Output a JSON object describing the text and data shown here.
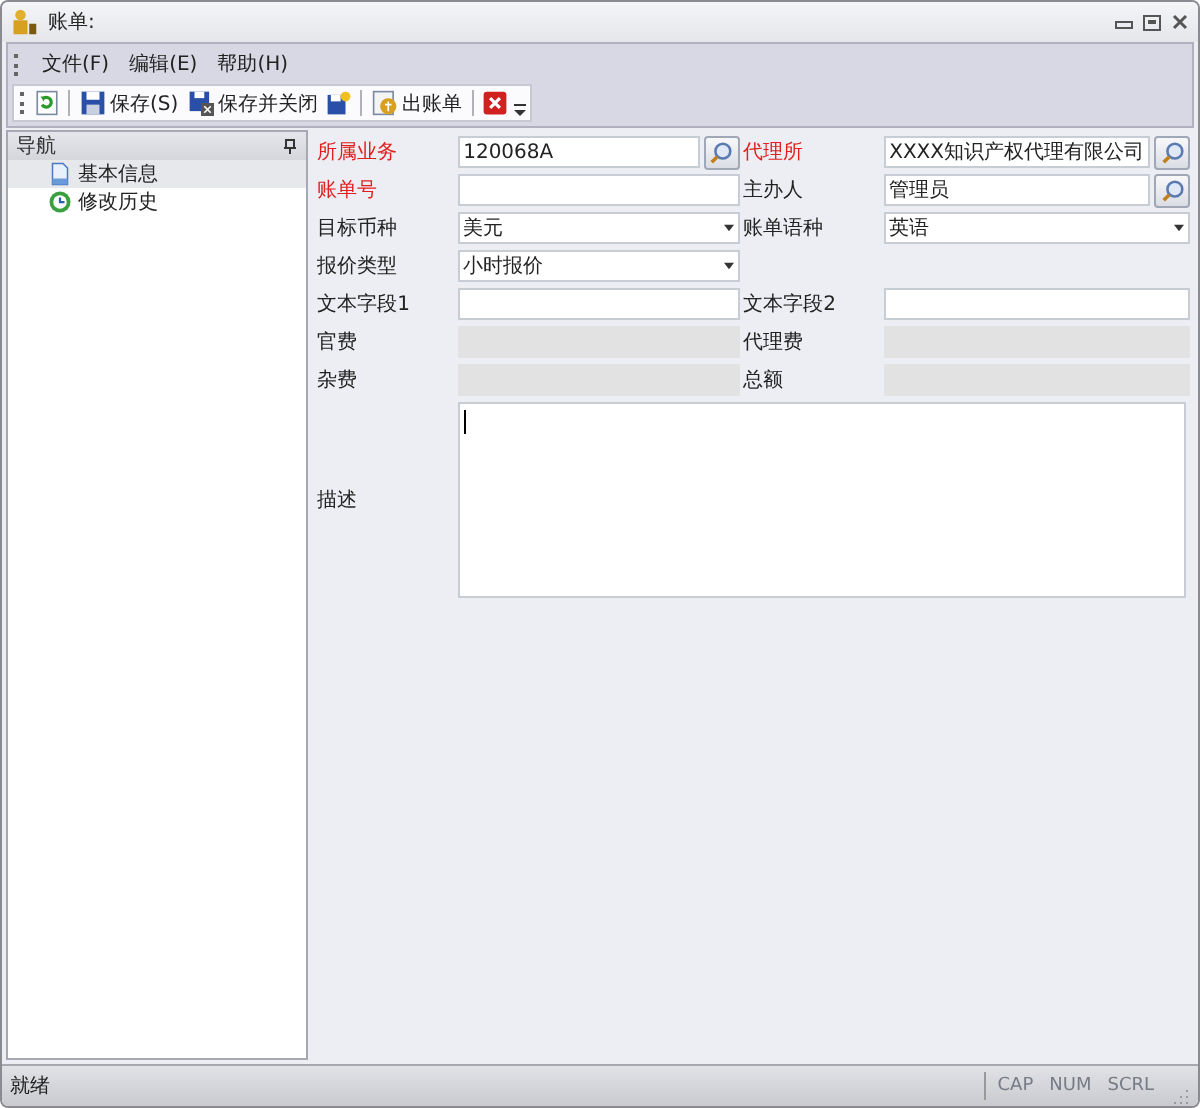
{
  "window": {
    "title": "账单:"
  },
  "menu": [
    "文件(F)",
    "编辑(E)",
    "帮助(H)"
  ],
  "toolbar": {
    "buttons": [
      "保存(S)",
      "保存并关闭",
      "出账单"
    ]
  },
  "navigation": {
    "title": "导航",
    "items": [
      {
        "label": "基本信息",
        "selected": true
      },
      {
        "label": "修改历史",
        "selected": false
      }
    ]
  },
  "form": {
    "rows": [
      [
        {
          "label": "所属业务",
          "required": true,
          "kind": "search",
          "value": "120068A"
        },
        {
          "label": "代理所",
          "required": true,
          "kind": "search",
          "value": "XXXX知识产权代理有限公司"
        }
      ],
      [
        {
          "label": "账单号",
          "required": true,
          "kind": "text"
        },
        {
          "label": "主办人",
          "required": false,
          "kind": "search",
          "value": "管理员"
        }
      ],
      [
        {
          "label": "目标币种",
          "required": false,
          "kind": "combo",
          "value": "美元"
        },
        {
          "label": "账单语种",
          "required": false,
          "kind": "combo",
          "value": "英语"
        }
      ],
      [
        {
          "label": "报价类型",
          "required": false,
          "kind": "combo",
          "value": "小时报价"
        }
      ],
      [
        {
          "label": "文本字段1",
          "required": false,
          "kind": "text"
        },
        {
          "label": "文本字段2",
          "required": false,
          "kind": "text"
        }
      ],
      [
        {
          "label": "官费",
          "required": false,
          "kind": "readonly"
        },
        {
          "label": "代理费",
          "required": false,
          "kind": "readonly"
        }
      ],
      [
        {
          "label": "杂费",
          "required": false,
          "kind": "readonly"
        },
        {
          "label": "总额",
          "required": false,
          "kind": "readonly"
        }
      ]
    ],
    "description": {
      "label": "描述"
    }
  },
  "status_bar": {
    "text": "就绪",
    "indicators": [
      {
        "label": "CAP",
        "on": false
      },
      {
        "label": "NUM",
        "on": false
      },
      {
        "label": "SCRL",
        "on": false
      }
    ]
  }
}
